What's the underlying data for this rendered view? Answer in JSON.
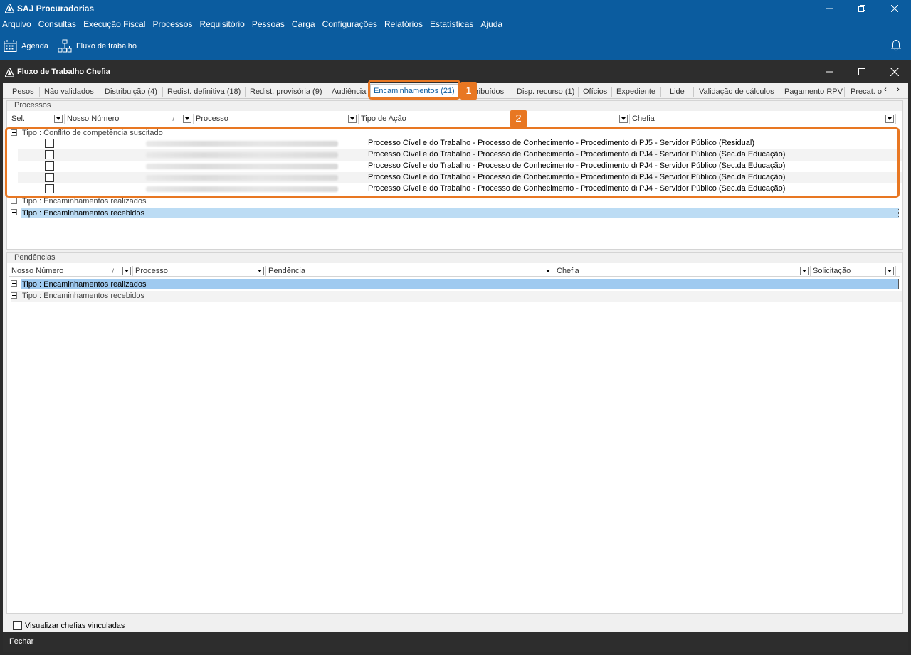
{
  "app": {
    "title": "SAJ Procuradorias",
    "menu": [
      "Arquivo",
      "Consultas",
      "Execução Fiscal",
      "Processos",
      "Requisitório",
      "Pessoas",
      "Carga",
      "Configurações",
      "Relatórios",
      "Estatísticas",
      "Ajuda"
    ],
    "toolbar": {
      "agenda": "Agenda",
      "fluxo": "Fluxo de trabalho"
    }
  },
  "window": {
    "title": "Fluxo de Trabalho Chefia"
  },
  "tabs": [
    "Pesos",
    "Não validados",
    "Distribuição (4)",
    "Redist. definitiva (18)",
    "Redist. provisória (9)",
    "Audiência",
    "Encaminhamentos (21)",
    "ribuídos",
    "Disp. recurso (1)",
    "Ofícios",
    "Expediente",
    "Lide",
    "Validação de cálculos",
    "Pagamento RPV",
    "Precat. o"
  ],
  "callouts": {
    "one": "1",
    "two": "2"
  },
  "processos": {
    "label": "Processos",
    "columns": {
      "sel": "Sel.",
      "nosso": "Nosso Número",
      "sort": "/",
      "processo": "Processo",
      "acao": "Tipo de Ação",
      "chefia": "Chefia"
    },
    "groups": {
      "conflito": "Tipo : Conflito de competência suscitado",
      "realizados": "Tipo : Encaminhamentos realizados",
      "recebidos": "Tipo : Encaminhamentos recebidos"
    },
    "rows": [
      {
        "acao": "Processo Cível e do Trabalho - Processo de Conhecimento - Procedimento de Conhecimento",
        "chefia": "PJ5 - Servidor Público (Residual)"
      },
      {
        "acao": "Processo Cível e do Trabalho - Processo de Conhecimento - Procedimento de Conhecimento",
        "chefia": "PJ4 - Servidor Público (Sec.da Educação)"
      },
      {
        "acao": "Processo Cível e do Trabalho - Processo de Conhecimento - Procedimento de Conhecimento",
        "chefia": "PJ4 - Servidor Público (Sec.da Educação)"
      },
      {
        "acao": "Processo Cível e do Trabalho - Processo de Conhecimento - Procedimento de Conhecimento",
        "chefia": "PJ4 - Servidor Público (Sec.da Educação)"
      },
      {
        "acao": "Processo Cível e do Trabalho - Processo de Conhecimento - Procedimento de Conhecimento",
        "chefia": "PJ4 - Servidor Público (Sec.da Educação)"
      }
    ]
  },
  "pendencias": {
    "label": "Pendências",
    "columns": {
      "nosso": "Nosso Número",
      "sort": "/",
      "processo": "Processo",
      "pendencia": "Pendência",
      "chefia": "Chefia",
      "solicitacao": "Solicitação"
    },
    "groups": {
      "realizados": "Tipo : Encaminhamentos realizados",
      "recebidos": "Tipo : Encaminhamentos recebidos"
    }
  },
  "footer": {
    "checkbox": "Visualizar chefias vinculadas",
    "close": "Fechar"
  }
}
